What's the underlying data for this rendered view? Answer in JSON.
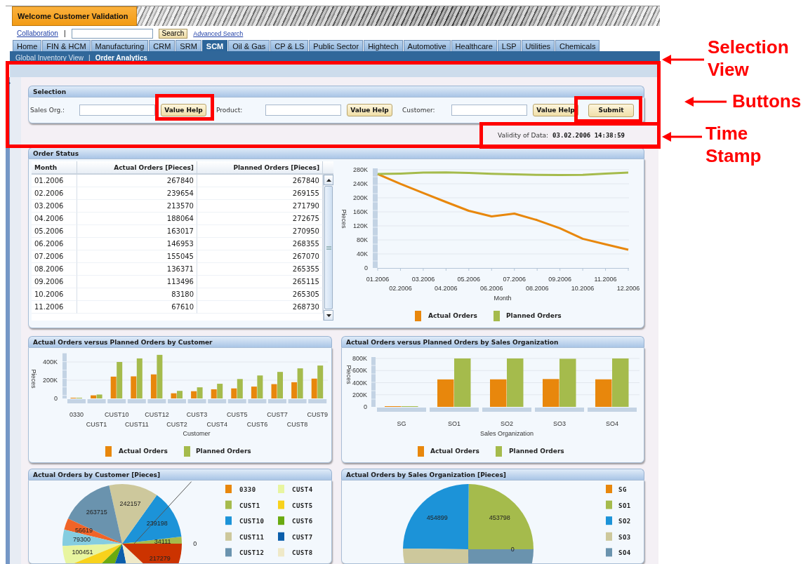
{
  "header": {
    "title": "Welcome Customer Validation"
  },
  "toolbar": {
    "link": "Collaboration",
    "separator": "|",
    "search_button": "Search",
    "advanced_search": "Advanced Search"
  },
  "tabs": [
    {
      "label": "Home",
      "selected": false
    },
    {
      "label": "FIN & HCM",
      "selected": false
    },
    {
      "label": "Manufacturing",
      "selected": false
    },
    {
      "label": "CRM",
      "selected": false
    },
    {
      "label": "SRM",
      "selected": false
    },
    {
      "label": "SCM",
      "selected": true
    },
    {
      "label": "Oil & Gas",
      "selected": false
    },
    {
      "label": "CP & LS",
      "selected": false
    },
    {
      "label": "Public Sector",
      "selected": false
    },
    {
      "label": "Hightech",
      "selected": false
    },
    {
      "label": "Automotive",
      "selected": false
    },
    {
      "label": "Healthcare",
      "selected": false
    },
    {
      "label": "LSP",
      "selected": false
    },
    {
      "label": "Utilities",
      "selected": false
    },
    {
      "label": "Chemicals",
      "selected": false
    }
  ],
  "subnav": {
    "separator": "|",
    "items": [
      {
        "label": "Global Inventory View",
        "selected": false
      },
      {
        "label": "Order Analytics",
        "selected": true
      }
    ]
  },
  "selection": {
    "title": "Selection",
    "fields": [
      {
        "label": "Sales Org.:",
        "button": "Value Help"
      },
      {
        "label": "Product:",
        "button": "Value Help"
      },
      {
        "label": "Customer:",
        "button": "Value Help"
      }
    ],
    "submit": "Submit"
  },
  "validity": {
    "label": "Validity of Data:",
    "value": "03.02.2006 14:38:59"
  },
  "order_status": {
    "title": "Order Status",
    "table": {
      "columns": [
        "Month",
        "Actual Orders [Pieces]",
        "Planned Orders [Pieces]"
      ],
      "rows": [
        [
          "01.2006",
          "267840",
          "267840"
        ],
        [
          "02.2006",
          "239654",
          "269155"
        ],
        [
          "03.2006",
          "213570",
          "271790"
        ],
        [
          "04.2006",
          "188064",
          "272675"
        ],
        [
          "05.2006",
          "163017",
          "270950"
        ],
        [
          "06.2006",
          "146953",
          "268355"
        ],
        [
          "07.2006",
          "155045",
          "267070"
        ],
        [
          "08.2006",
          "136371",
          "265355"
        ],
        [
          "09.2006",
          "113496",
          "265115"
        ],
        [
          "10.2006",
          "83180",
          "265305"
        ],
        [
          "11.2006",
          "67610",
          "268730"
        ]
      ]
    },
    "chart_data": {
      "type": "line",
      "xlabel": "Month",
      "ylabel": "Pieces",
      "legend": "bottom",
      "grid": true,
      "categories": [
        "01.2006",
        "02.2006",
        "03.2006",
        "04.2006",
        "05.2006",
        "06.2006",
        "07.2006",
        "08.2006",
        "09.2006",
        "10.2006",
        "11.2006",
        "12.2006"
      ],
      "series": [
        {
          "name": "Actual Orders",
          "color": "#e8870c",
          "values": [
            267840,
            239654,
            213570,
            188064,
            163017,
            146953,
            155045,
            136371,
            113496,
            83180,
            67610,
            52000
          ]
        },
        {
          "name": "Planned Orders",
          "color": "#a5bb4c",
          "values": [
            267840,
            269155,
            271790,
            272675,
            270950,
            268355,
            267070,
            265355,
            265115,
            265305,
            268730,
            272000
          ]
        }
      ],
      "ylim": [
        0,
        280000
      ],
      "yticks": [
        {
          "value": 0,
          "label": "0"
        },
        {
          "value": 40000,
          "label": "40K"
        },
        {
          "value": 80000,
          "label": "80K"
        },
        {
          "value": 120000,
          "label": "120K"
        },
        {
          "value": 160000,
          "label": "160K"
        },
        {
          "value": 200000,
          "label": "200K"
        },
        {
          "value": 240000,
          "label": "240K"
        },
        {
          "value": 280000,
          "label": "280K"
        }
      ]
    }
  },
  "charts": [
    {
      "title": "Actual Orders versus Planned Orders by Customer",
      "chart_data": {
        "type": "bar",
        "xlabel": "Customer",
        "ylabel": "Pieces",
        "legend": "bottom",
        "grid": true,
        "categories": [
          "0330",
          "CUST1",
          "CUST10",
          "CUST11",
          "CUST12",
          "CUST2",
          "CUST3",
          "CUST4",
          "CUST5",
          "CUST6",
          "CUST7",
          "CUST8",
          "CUST9"
        ],
        "series": [
          {
            "name": "Actual Orders",
            "color": "#e8870c",
            "values": [
              0,
              34111,
              239198,
              242157,
              263715,
              56619,
              79300,
              100451,
              110000,
              130000,
              157000,
              178000,
              217279
            ]
          },
          {
            "name": "Planned Orders",
            "color": "#a5bb4c",
            "values": [
              0,
              43000,
              400000,
              439000,
              478000,
              83000,
              122000,
              161000,
              213000,
              252000,
              291000,
              330000,
              361000
            ]
          }
        ],
        "ylim": [
          0,
          480000
        ],
        "yticks": [
          {
            "value": 0,
            "label": "0"
          },
          {
            "value": 200000,
            "label": "200K"
          },
          {
            "value": 400000,
            "label": "400K"
          }
        ]
      }
    },
    {
      "title": "Actual Orders versus Planned Orders by Sales Organization",
      "chart_data": {
        "type": "bar",
        "xlabel": "Sales Organization",
        "ylabel": "Pieces",
        "legend": "bottom",
        "grid": true,
        "categories": [
          "SG",
          "SO1",
          "SO2",
          "SO3",
          "SO4"
        ],
        "series": [
          {
            "name": "Actual Orders",
            "color": "#e8870c",
            "values": [
              0,
              453798,
              454899,
              460000,
              455000
            ]
          },
          {
            "name": "Planned Orders",
            "color": "#a5bb4c",
            "values": [
              0,
              800000,
              800000,
              795000,
              800000
            ]
          }
        ],
        "ylim": [
          0,
          800000
        ],
        "yticks": [
          {
            "value": 0,
            "label": "0"
          },
          {
            "value": 200000,
            "label": "200K"
          },
          {
            "value": 400000,
            "label": "400K"
          },
          {
            "value": 600000,
            "label": "600K"
          },
          {
            "value": 800000,
            "label": "800K"
          }
        ]
      }
    }
  ],
  "pies": [
    {
      "title": "Actual Orders by Customer [Pieces]",
      "chart_data": {
        "type": "pie",
        "values": [
          0,
          34111,
          239198,
          242157,
          263715,
          56619,
          79300,
          100451,
          110000,
          130000,
          157000,
          178000,
          217279
        ],
        "colors": [
          "#e8870c",
          "#a5bb4c",
          "#1c93d8",
          "#cdc89c",
          "#6a93ae",
          "#f06428",
          "#85cde0",
          "#e8f5a0",
          "#f8d21c",
          "#6aaa10",
          "#0b5eab",
          "#efe9c8",
          "#cc3300"
        ],
        "value_labels": [
          "0",
          "34111",
          "239198",
          "242157",
          "263715",
          "56619",
          "79300",
          "100451",
          null,
          null,
          null,
          null,
          "217279"
        ]
      },
      "legend": [
        {
          "label": "0330",
          "color": "#e8870c"
        },
        {
          "label": "CUST1",
          "color": "#a5bb4c"
        },
        {
          "label": "CUST10",
          "color": "#1c93d8"
        },
        {
          "label": "CUST11",
          "color": "#cdc89c"
        },
        {
          "label": "CUST12",
          "color": "#6a93ae"
        },
        {
          "label": "CUST4",
          "color": "#e8f5a0"
        },
        {
          "label": "CUST5",
          "color": "#f8d21c"
        },
        {
          "label": "CUST6",
          "color": "#6aaa10"
        },
        {
          "label": "CUST7",
          "color": "#0b5eab"
        },
        {
          "label": "CUST8",
          "color": "#efe9c8"
        }
      ]
    },
    {
      "title": "Actual Orders by Sales Organization [Pieces]",
      "chart_data": {
        "type": "pie",
        "values": [
          0,
          453798,
          454899,
          460000,
          455000
        ],
        "colors": [
          "#e8870c",
          "#a5bb4c",
          "#1c93d8",
          "#cdc89c",
          "#6a93ae"
        ],
        "value_labels": [
          "0",
          "453798",
          "454899",
          null,
          null
        ]
      },
      "legend": [
        {
          "label": "SG",
          "color": "#e8870c"
        },
        {
          "label": "SO1",
          "color": "#a5bb4c"
        },
        {
          "label": "SO2",
          "color": "#1c93d8"
        },
        {
          "label": "SO3",
          "color": "#cdc89c"
        },
        {
          "label": "SO4",
          "color": "#6a93ae"
        }
      ]
    }
  ],
  "annotations": [
    {
      "text": "Selection View"
    },
    {
      "text": "Buttons"
    },
    {
      "text": "Time Stamp"
    }
  ]
}
